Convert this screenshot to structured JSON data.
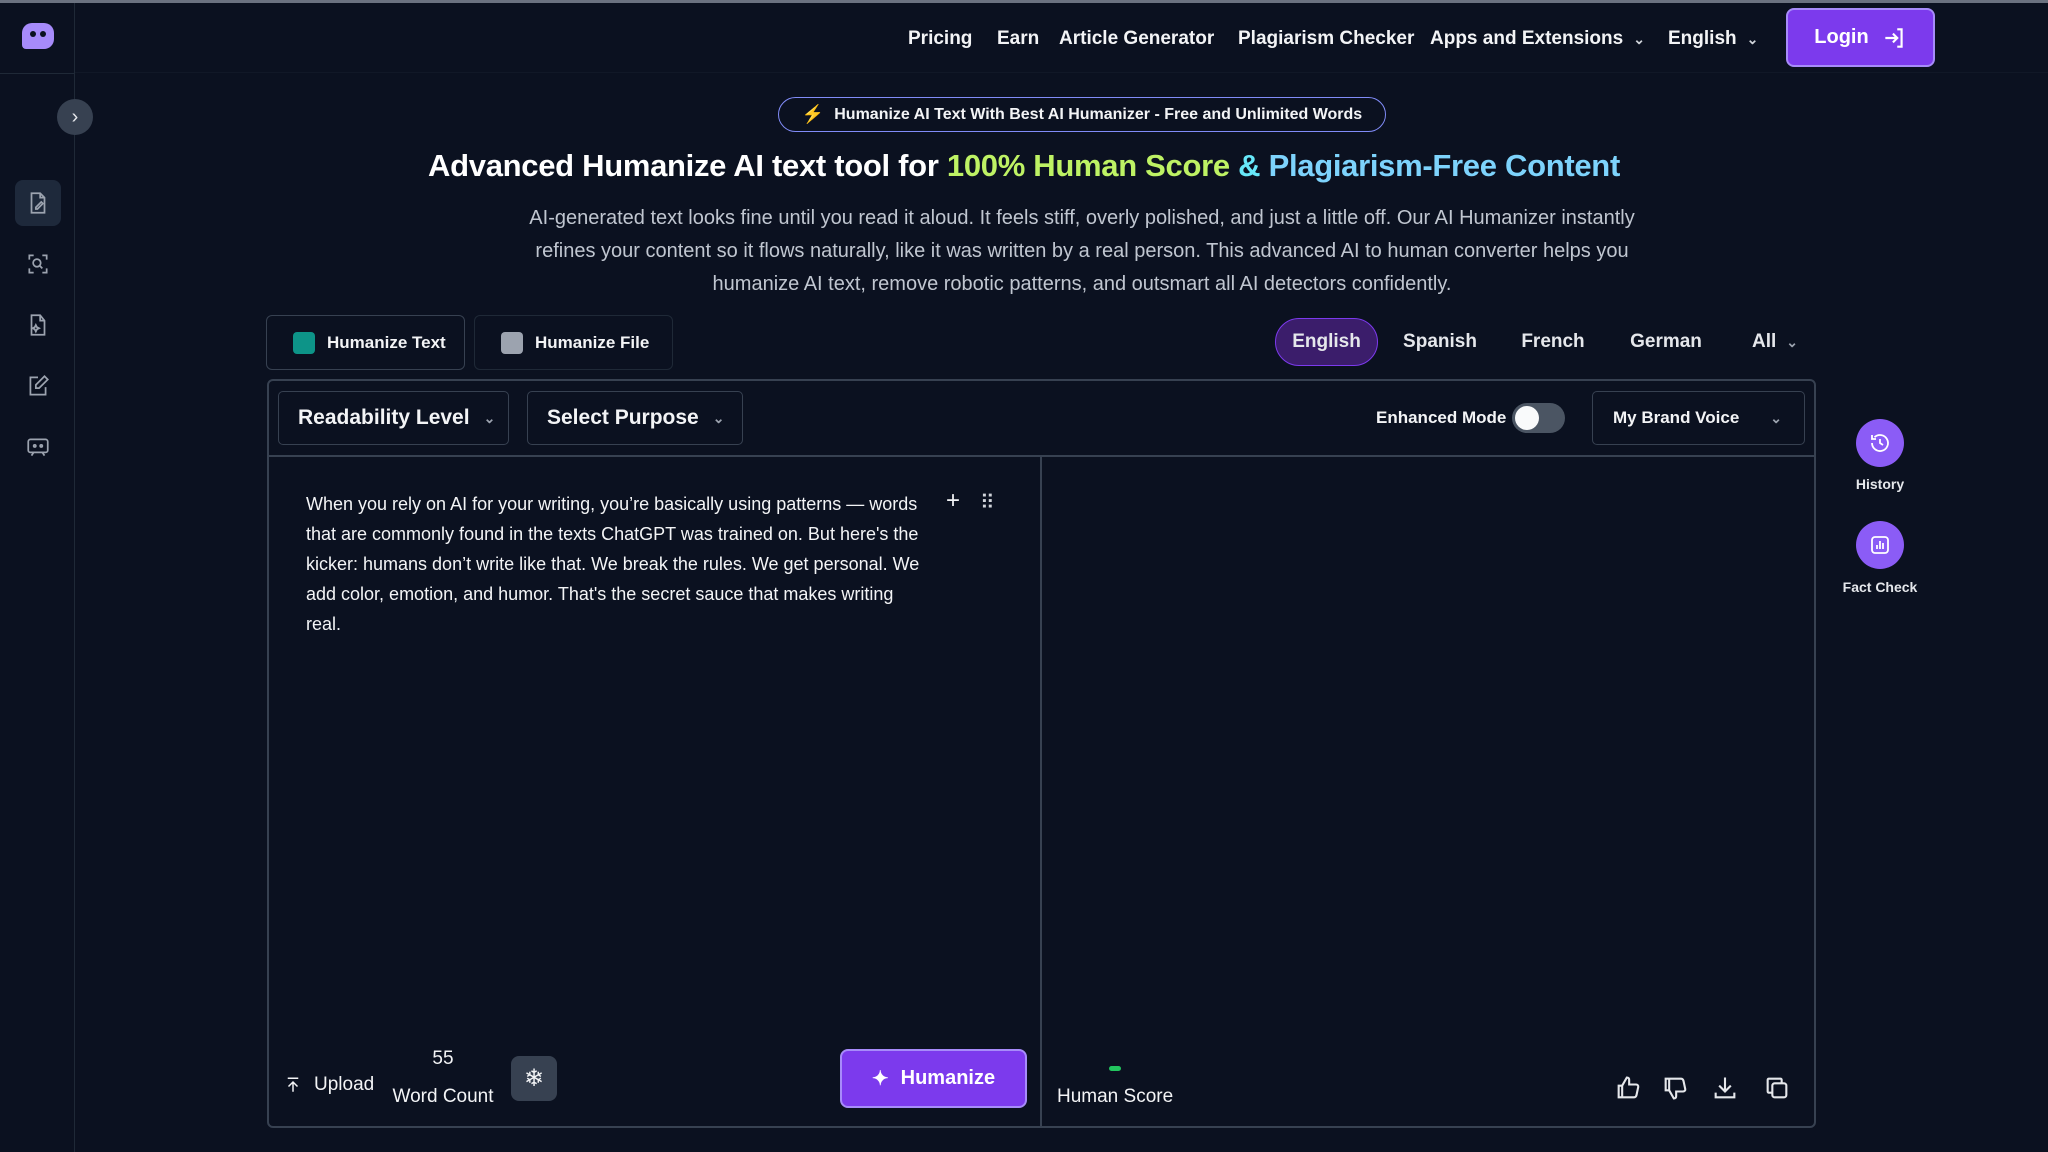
{
  "header": {
    "nav": {
      "pricing": "Pricing",
      "earn": "Earn",
      "article_generator": "Article Generator",
      "plagiarism_checker": "Plagiarism Checker",
      "apps_extensions": "Apps and Extensions",
      "language": "English"
    },
    "login_label": "Login"
  },
  "hero": {
    "pill_text": "Humanize AI Text With Best AI Humanizer - Free and Unlimited Words",
    "title_prefix": "Advanced Humanize AI text tool for ",
    "title_highlight_1": "100% Human Score",
    "title_amp": " & ",
    "title_highlight_2": "Plagiarism-Free Content",
    "description": "AI-generated text looks fine until you read it aloud. It feels stiff, overly polished, and just a little off. Our AI Humanizer instantly refines your content so it flows naturally, like it was written by a real person. This advanced AI to human converter helps you humanize AI text, remove robotic patterns, and outsmart all AI detectors confidently."
  },
  "mode_tabs": {
    "humanize_text": "Humanize Text",
    "humanize_file": "Humanize File"
  },
  "languages": {
    "english": "English",
    "spanish": "Spanish",
    "french": "French",
    "german": "German",
    "all": "All"
  },
  "editor": {
    "readability_label": "Readability Level",
    "purpose_label": "Select Purpose",
    "enhanced_mode_label": "Enhanced Mode",
    "enhanced_mode_on": false,
    "brand_voice_label": "My Brand Voice",
    "input_text": "When you rely on AI for your writing, you’re basically using patterns — words that are commonly found in the texts ChatGPT was trained on. But here's the kicker: humans don’t write like that. We break the rules. We get personal. We add color, emotion, and humor. That's the secret sauce that makes writing real.",
    "upload_label": "Upload",
    "word_count": "55",
    "word_count_label": "Word Count",
    "humanize_label": "Humanize",
    "human_score_label": "Human Score"
  },
  "right_rail": {
    "history_label": "History",
    "fact_check_label": "Fact Check"
  },
  "colors": {
    "accent": "#7c3aed",
    "accent_light": "#8b5cf6",
    "background": "#0b1120",
    "highlight_green": "#bef264",
    "highlight_cyan": "#67e8f9",
    "score_green": "#22c55e"
  },
  "icons": {
    "sidebar": [
      "document-edit-icon",
      "scan-search-icon",
      "file-ai-icon",
      "pencil-note-icon",
      "chat-bot-icon"
    ],
    "output_actions": [
      "thumbs-up-icon",
      "thumbs-down-icon",
      "download-icon",
      "copy-icon"
    ]
  }
}
